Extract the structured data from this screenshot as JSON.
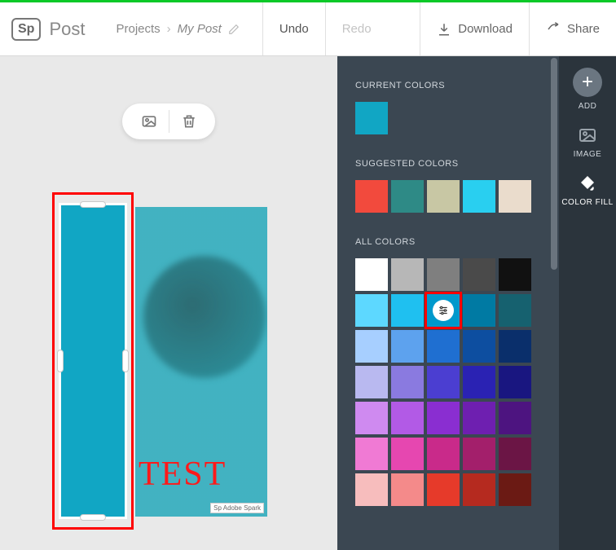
{
  "header": {
    "logo": "Sp",
    "brand": "Post",
    "breadcrumb": {
      "root": "Projects",
      "current": "My Post"
    },
    "undo": "Undo",
    "redo": "Redo",
    "download": "Download",
    "share": "Share"
  },
  "canvas": {
    "text": "TEST",
    "watermark": "Sp Adobe Spark"
  },
  "panel": {
    "current_label": "CURRENT COLORS",
    "current": [
      "#11a6c4"
    ],
    "suggested_label": "SUGGESTED COLORS",
    "suggested": [
      "#f24a3d",
      "#2e8a86",
      "#c8c7a4",
      "#29cff0",
      "#eadccc"
    ],
    "all_label": "ALL COLORS",
    "all": [
      "#ffffff",
      "#b7b7b7",
      "#7f7f7f",
      "#4a4a4a",
      "#111111",
      "#5dd8ff",
      "#1fc0f0",
      "#0099cc",
      "#007aa3",
      "#16616f",
      "#a7cfff",
      "#5da2ee",
      "#1f6fd1",
      "#0d4ea0",
      "#0a2f6b",
      "#b9b9f0",
      "#8a7ae0",
      "#4b3ed1",
      "#2a22b3",
      "#191680",
      "#cf8af0",
      "#b25ae6",
      "#8a2ed1",
      "#6e1fb0",
      "#4d1480",
      "#f07ad4",
      "#e647b0",
      "#c92a8a",
      "#a31f6b",
      "#6b1545",
      "#f7bdbd",
      "#f48a8a",
      "#e63a2a",
      "#b52a1f",
      "#6b1a14"
    ],
    "selected_index": 7
  },
  "rail": {
    "add": "ADD",
    "image": "IMAGE",
    "colorfill": "COLOR FILL"
  }
}
